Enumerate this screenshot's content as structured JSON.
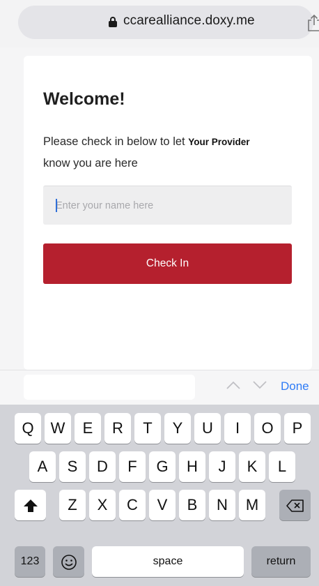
{
  "browser": {
    "url": "ccarealliance.doxy.me"
  },
  "checkin": {
    "title": "Welcome!",
    "message_prefix": "Please check in below to let",
    "provider": "Your Provider",
    "message_suffix": "know you are here",
    "name_placeholder": "Enter your name here",
    "name_value": "",
    "button_label": "Check In",
    "accent_color": "#b5202e"
  },
  "accessory_bar": {
    "done_label": "Done"
  },
  "keyboard": {
    "row1": [
      "Q",
      "W",
      "E",
      "R",
      "T",
      "Y",
      "U",
      "I",
      "O",
      "P"
    ],
    "row2": [
      "A",
      "S",
      "D",
      "F",
      "G",
      "H",
      "J",
      "K",
      "L"
    ],
    "row3": [
      "Z",
      "X",
      "C",
      "V",
      "B",
      "N",
      "M"
    ],
    "numbers_label": "123",
    "space_label": "space",
    "return_label": "return"
  }
}
